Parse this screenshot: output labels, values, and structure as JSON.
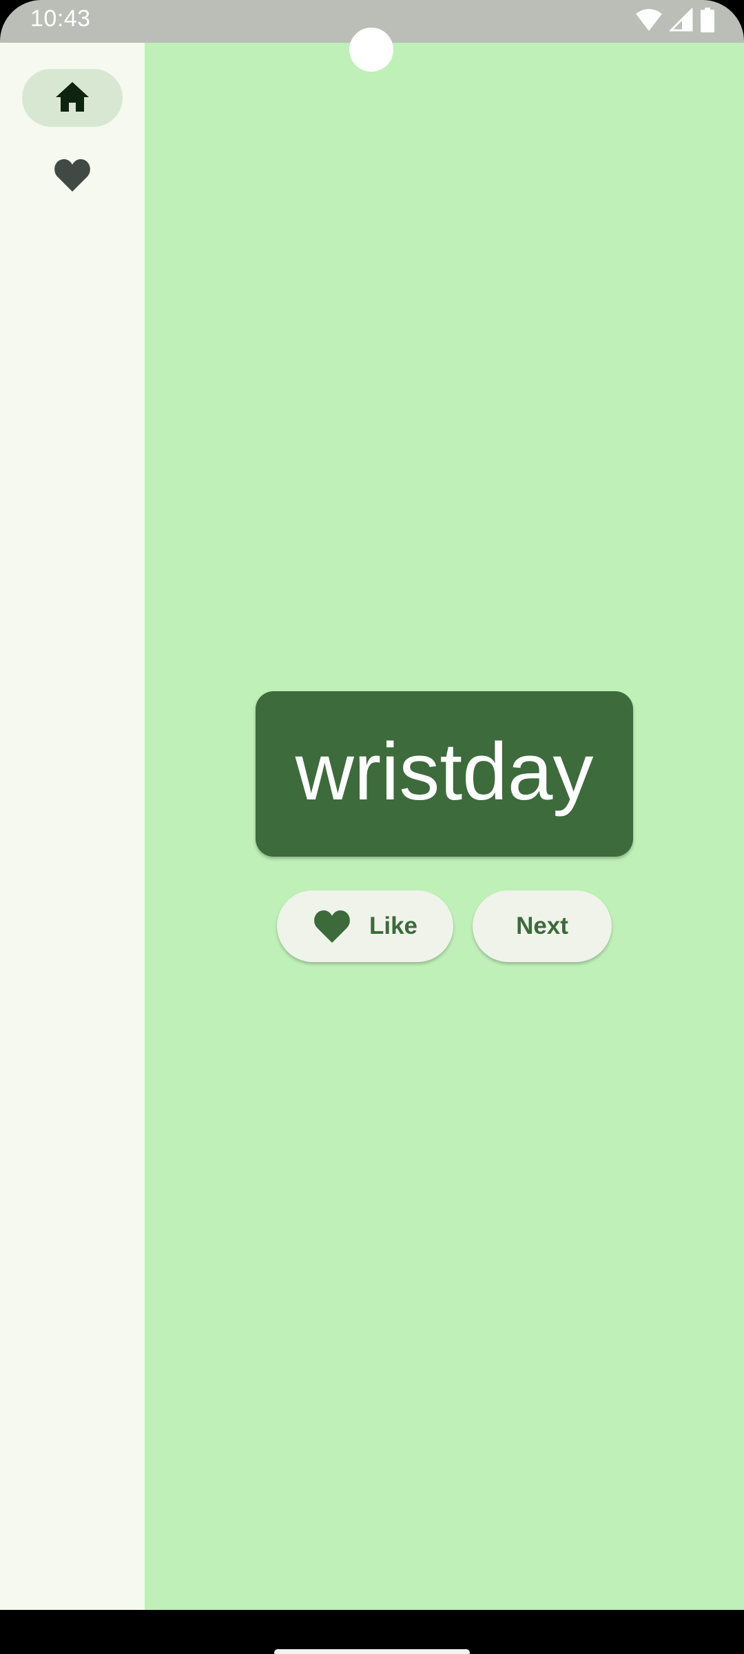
{
  "status_bar": {
    "time": "10:43",
    "icons": [
      "wifi-icon",
      "signal-icon",
      "battery-icon"
    ]
  },
  "nav_rail": {
    "items": [
      {
        "name": "home",
        "icon": "home-icon",
        "selected": true
      },
      {
        "name": "favorites",
        "icon": "heart-icon",
        "selected": false
      }
    ]
  },
  "main": {
    "word": "wristday",
    "like_button": {
      "label": "Like",
      "icon": "heart-icon"
    },
    "next_button": {
      "label": "Next"
    }
  },
  "colors": {
    "status_bar": "#bbbdb7",
    "nav_rail_bg": "#f5f9f0",
    "nav_selected_pill": "#d8e7d1",
    "main_bg": "#bff0b8",
    "card_bg": "#3d6b3c",
    "button_bg": "#eff3ea",
    "button_text": "#3c6a3a"
  }
}
